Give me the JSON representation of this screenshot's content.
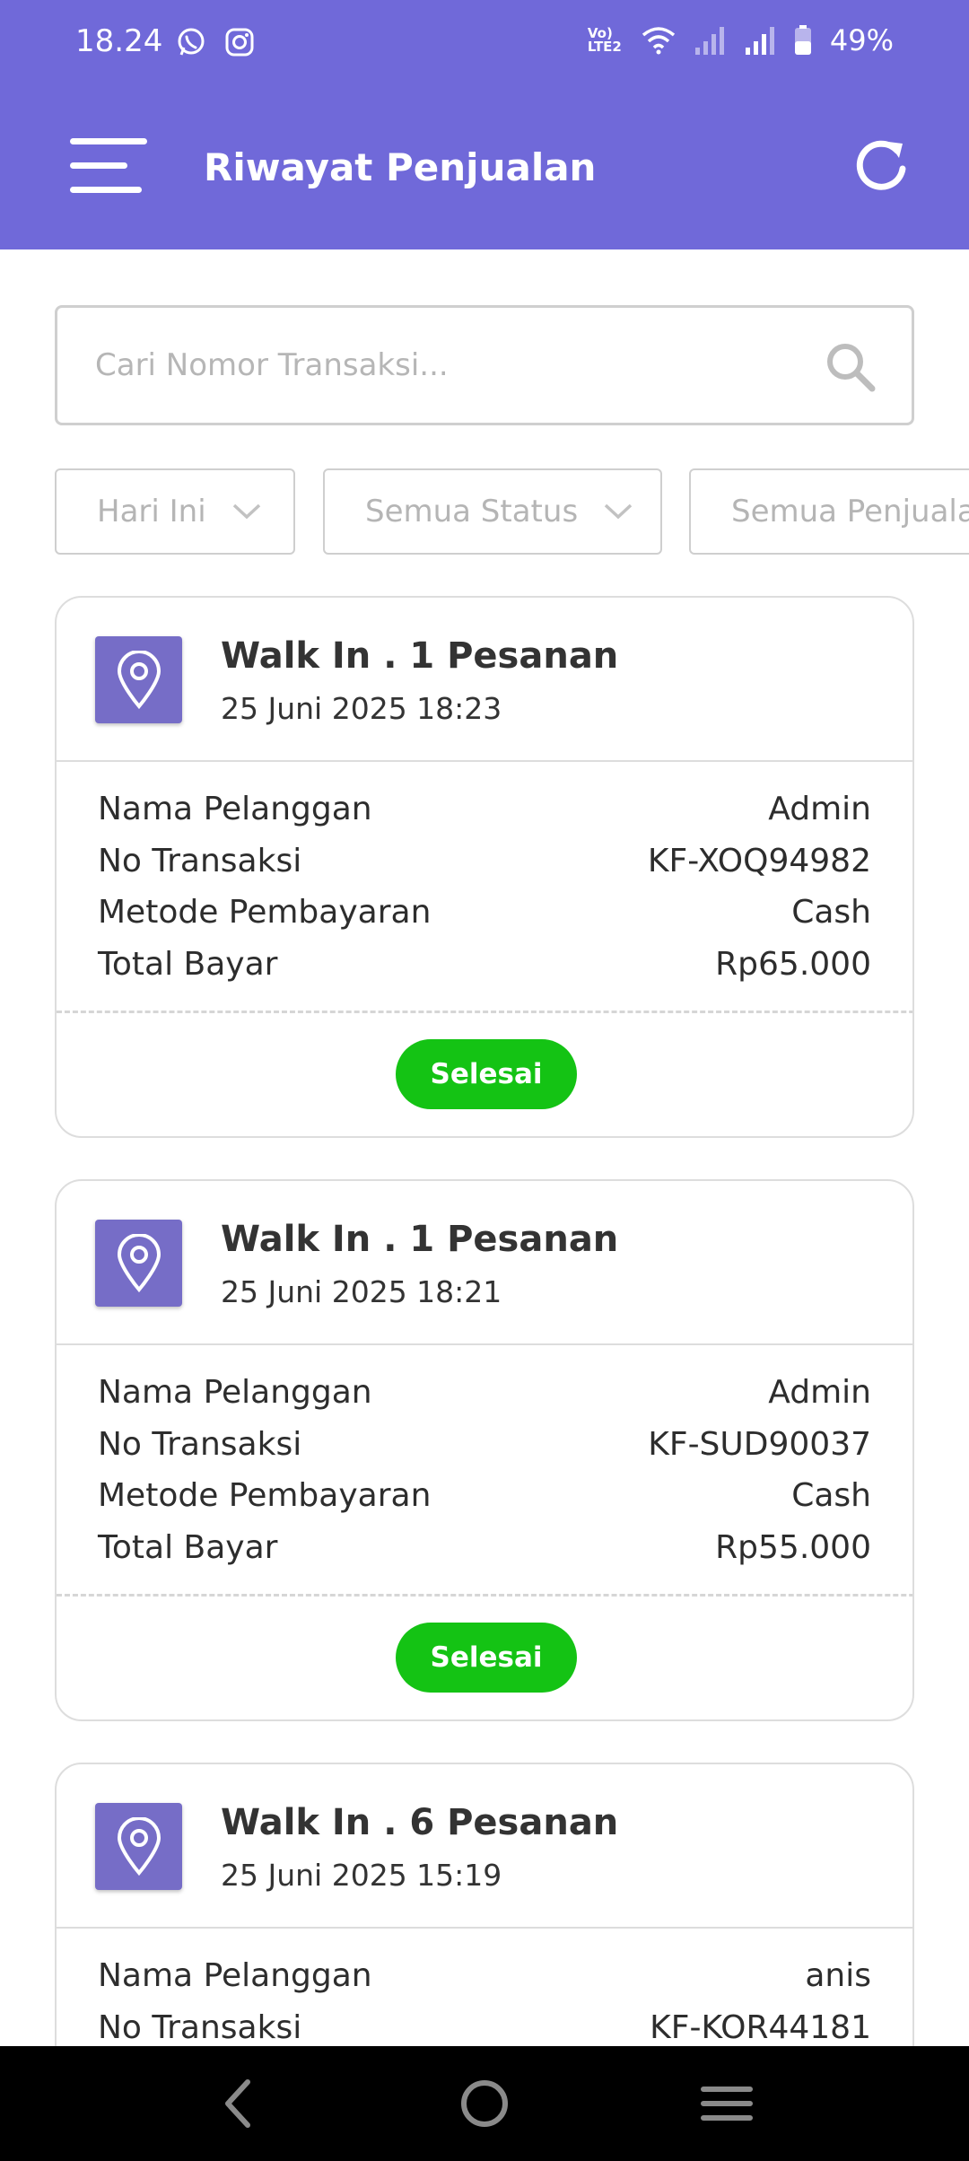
{
  "status_bar": {
    "time": "18.24",
    "network_label": "Vo) LTE2",
    "battery": "49%",
    "icons": [
      "whatsapp-icon",
      "instagram-icon",
      "volte-icon",
      "wifi-icon",
      "signal-icon",
      "signal-icon",
      "battery-icon"
    ]
  },
  "header": {
    "title": "Riwayat Penjualan",
    "background": "#7069d9",
    "icons": [
      "menu-icon",
      "refresh-icon"
    ]
  },
  "search": {
    "placeholder": "Cari Nomor Transaksi...",
    "value": "",
    "icon": "search-icon"
  },
  "filters": [
    {
      "label": "Hari Ini"
    },
    {
      "label": "Semua Status"
    },
    {
      "label": "Semua Penjualan"
    }
  ],
  "labels": {
    "customer": "Nama Pelanggan",
    "transaction_no": "No Transaksi",
    "payment_method": "Metode Pembayaran",
    "total": "Total Bayar"
  },
  "orders": [
    {
      "title": "Walk In . 1 Pesanan",
      "date": "25 Juni 2025 18:23",
      "customer": "Admin",
      "transaction_no": "KF-XOQ94982",
      "payment_method": "Cash",
      "total": "Rp65.000",
      "status": "Selesai"
    },
    {
      "title": "Walk In . 1 Pesanan",
      "date": "25 Juni 2025 18:21",
      "customer": "Admin",
      "transaction_no": "KF-SUD90037",
      "payment_method": "Cash",
      "total": "Rp55.000",
      "status": "Selesai"
    },
    {
      "title": "Walk In . 6 Pesanan",
      "date": "25 Juni 2025 15:19",
      "customer": "anis",
      "transaction_no": "KF-KOR44181"
    }
  ],
  "colors": {
    "accent": "#7069d9",
    "icon_tile": "#766dc7",
    "status_done": "#14c314"
  },
  "nav": {
    "icons": [
      "back-icon",
      "home-icon",
      "recents-icon"
    ]
  }
}
